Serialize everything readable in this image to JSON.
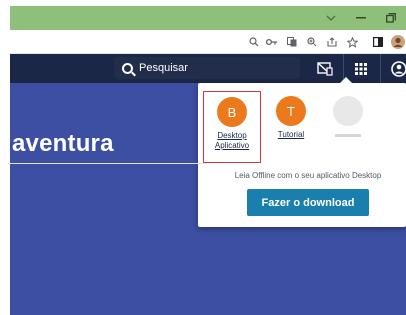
{
  "window": {
    "controls": [
      {
        "name": "chevron-down-icon",
        "glyph": "∨"
      },
      {
        "name": "minimize-icon",
        "glyph": "–"
      },
      {
        "name": "restore-icon",
        "glyph": "◻"
      }
    ]
  },
  "toolbar": {
    "icons": [
      "search-icon",
      "key-icon",
      "translate-icon",
      "zoom-icon",
      "share-icon",
      "star-icon",
      "sidepanel-icon",
      "profile-avatar-icon"
    ]
  },
  "navbar": {
    "search_placeholder": "Pesquisar",
    "icons": [
      "offline-device-icon",
      "apps-grid-icon",
      "user-circle-icon"
    ]
  },
  "hero": {
    "text": "aventura"
  },
  "accounts": [
    {
      "initial": "B",
      "label": "Desktop Aplicativo",
      "selected": true
    },
    {
      "initial": "T",
      "label": "Tutorial",
      "selected": false
    },
    {
      "initial": "",
      "label": "",
      "selected": false
    }
  ],
  "panel": {
    "offline_text": "Leia Offline com o seu aplicativo Desktop",
    "download_label": "Fazer o download"
  },
  "colors": {
    "title_bar": "#8ec07b",
    "navbar": "#1b2746",
    "page_bg": "#3c4fa2",
    "avatar": "#ec7a1c",
    "download_button": "#1b7fae",
    "selection_border": "#d9363e"
  }
}
